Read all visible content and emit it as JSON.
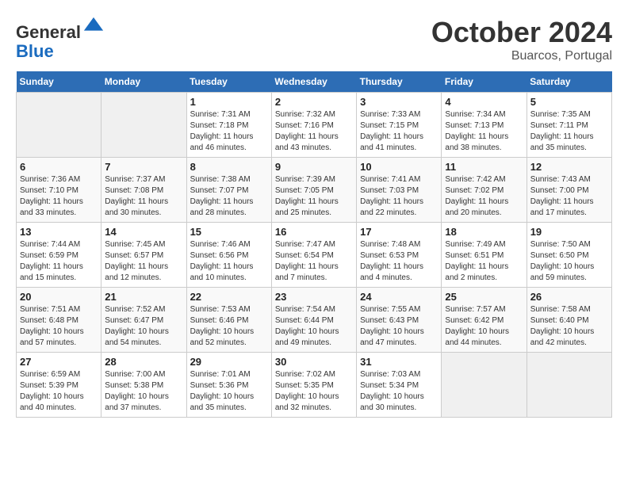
{
  "header": {
    "logo_line1": "General",
    "logo_line2": "Blue",
    "month": "October 2024",
    "location": "Buarcos, Portugal"
  },
  "weekdays": [
    "Sunday",
    "Monday",
    "Tuesday",
    "Wednesday",
    "Thursday",
    "Friday",
    "Saturday"
  ],
  "weeks": [
    [
      {
        "day": "",
        "info": ""
      },
      {
        "day": "",
        "info": ""
      },
      {
        "day": "1",
        "info": "Sunrise: 7:31 AM\nSunset: 7:18 PM\nDaylight: 11 hours and 46 minutes."
      },
      {
        "day": "2",
        "info": "Sunrise: 7:32 AM\nSunset: 7:16 PM\nDaylight: 11 hours and 43 minutes."
      },
      {
        "day": "3",
        "info": "Sunrise: 7:33 AM\nSunset: 7:15 PM\nDaylight: 11 hours and 41 minutes."
      },
      {
        "day": "4",
        "info": "Sunrise: 7:34 AM\nSunset: 7:13 PM\nDaylight: 11 hours and 38 minutes."
      },
      {
        "day": "5",
        "info": "Sunrise: 7:35 AM\nSunset: 7:11 PM\nDaylight: 11 hours and 35 minutes."
      }
    ],
    [
      {
        "day": "6",
        "info": "Sunrise: 7:36 AM\nSunset: 7:10 PM\nDaylight: 11 hours and 33 minutes."
      },
      {
        "day": "7",
        "info": "Sunrise: 7:37 AM\nSunset: 7:08 PM\nDaylight: 11 hours and 30 minutes."
      },
      {
        "day": "8",
        "info": "Sunrise: 7:38 AM\nSunset: 7:07 PM\nDaylight: 11 hours and 28 minutes."
      },
      {
        "day": "9",
        "info": "Sunrise: 7:39 AM\nSunset: 7:05 PM\nDaylight: 11 hours and 25 minutes."
      },
      {
        "day": "10",
        "info": "Sunrise: 7:41 AM\nSunset: 7:03 PM\nDaylight: 11 hours and 22 minutes."
      },
      {
        "day": "11",
        "info": "Sunrise: 7:42 AM\nSunset: 7:02 PM\nDaylight: 11 hours and 20 minutes."
      },
      {
        "day": "12",
        "info": "Sunrise: 7:43 AM\nSunset: 7:00 PM\nDaylight: 11 hours and 17 minutes."
      }
    ],
    [
      {
        "day": "13",
        "info": "Sunrise: 7:44 AM\nSunset: 6:59 PM\nDaylight: 11 hours and 15 minutes."
      },
      {
        "day": "14",
        "info": "Sunrise: 7:45 AM\nSunset: 6:57 PM\nDaylight: 11 hours and 12 minutes."
      },
      {
        "day": "15",
        "info": "Sunrise: 7:46 AM\nSunset: 6:56 PM\nDaylight: 11 hours and 10 minutes."
      },
      {
        "day": "16",
        "info": "Sunrise: 7:47 AM\nSunset: 6:54 PM\nDaylight: 11 hours and 7 minutes."
      },
      {
        "day": "17",
        "info": "Sunrise: 7:48 AM\nSunset: 6:53 PM\nDaylight: 11 hours and 4 minutes."
      },
      {
        "day": "18",
        "info": "Sunrise: 7:49 AM\nSunset: 6:51 PM\nDaylight: 11 hours and 2 minutes."
      },
      {
        "day": "19",
        "info": "Sunrise: 7:50 AM\nSunset: 6:50 PM\nDaylight: 10 hours and 59 minutes."
      }
    ],
    [
      {
        "day": "20",
        "info": "Sunrise: 7:51 AM\nSunset: 6:48 PM\nDaylight: 10 hours and 57 minutes."
      },
      {
        "day": "21",
        "info": "Sunrise: 7:52 AM\nSunset: 6:47 PM\nDaylight: 10 hours and 54 minutes."
      },
      {
        "day": "22",
        "info": "Sunrise: 7:53 AM\nSunset: 6:46 PM\nDaylight: 10 hours and 52 minutes."
      },
      {
        "day": "23",
        "info": "Sunrise: 7:54 AM\nSunset: 6:44 PM\nDaylight: 10 hours and 49 minutes."
      },
      {
        "day": "24",
        "info": "Sunrise: 7:55 AM\nSunset: 6:43 PM\nDaylight: 10 hours and 47 minutes."
      },
      {
        "day": "25",
        "info": "Sunrise: 7:57 AM\nSunset: 6:42 PM\nDaylight: 10 hours and 44 minutes."
      },
      {
        "day": "26",
        "info": "Sunrise: 7:58 AM\nSunset: 6:40 PM\nDaylight: 10 hours and 42 minutes."
      }
    ],
    [
      {
        "day": "27",
        "info": "Sunrise: 6:59 AM\nSunset: 5:39 PM\nDaylight: 10 hours and 40 minutes."
      },
      {
        "day": "28",
        "info": "Sunrise: 7:00 AM\nSunset: 5:38 PM\nDaylight: 10 hours and 37 minutes."
      },
      {
        "day": "29",
        "info": "Sunrise: 7:01 AM\nSunset: 5:36 PM\nDaylight: 10 hours and 35 minutes."
      },
      {
        "day": "30",
        "info": "Sunrise: 7:02 AM\nSunset: 5:35 PM\nDaylight: 10 hours and 32 minutes."
      },
      {
        "day": "31",
        "info": "Sunrise: 7:03 AM\nSunset: 5:34 PM\nDaylight: 10 hours and 30 minutes."
      },
      {
        "day": "",
        "info": ""
      },
      {
        "day": "",
        "info": ""
      }
    ]
  ]
}
